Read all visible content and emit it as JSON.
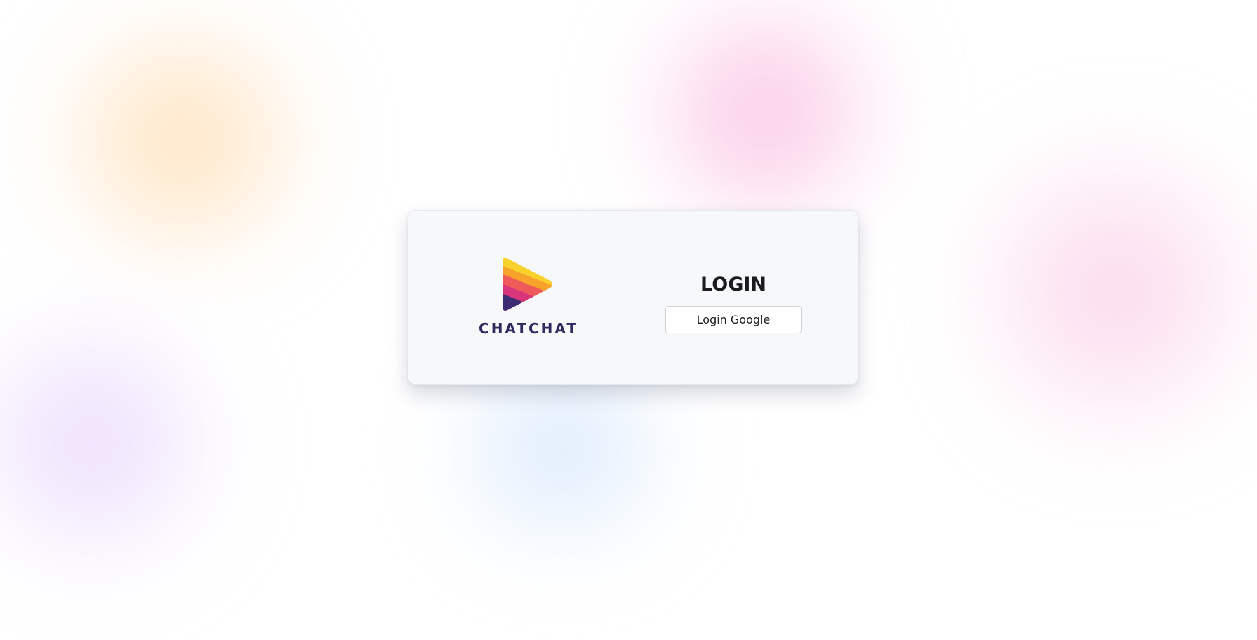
{
  "brand": {
    "name": "CHATCHAT",
    "logo_icon": "play-triangle-logo-icon",
    "logo_colors": [
      "#f9d12c",
      "#f7a22a",
      "#ef5b5b",
      "#d9357a",
      "#3b2c73"
    ]
  },
  "login": {
    "title": "LOGIN",
    "google_button_label": "Login Google"
  },
  "background": {
    "blob_colors": [
      "#ffd6a0",
      "#f7aad7",
      "#f8b9dc",
      "#e1c8fa",
      "#c3dcfa"
    ]
  }
}
